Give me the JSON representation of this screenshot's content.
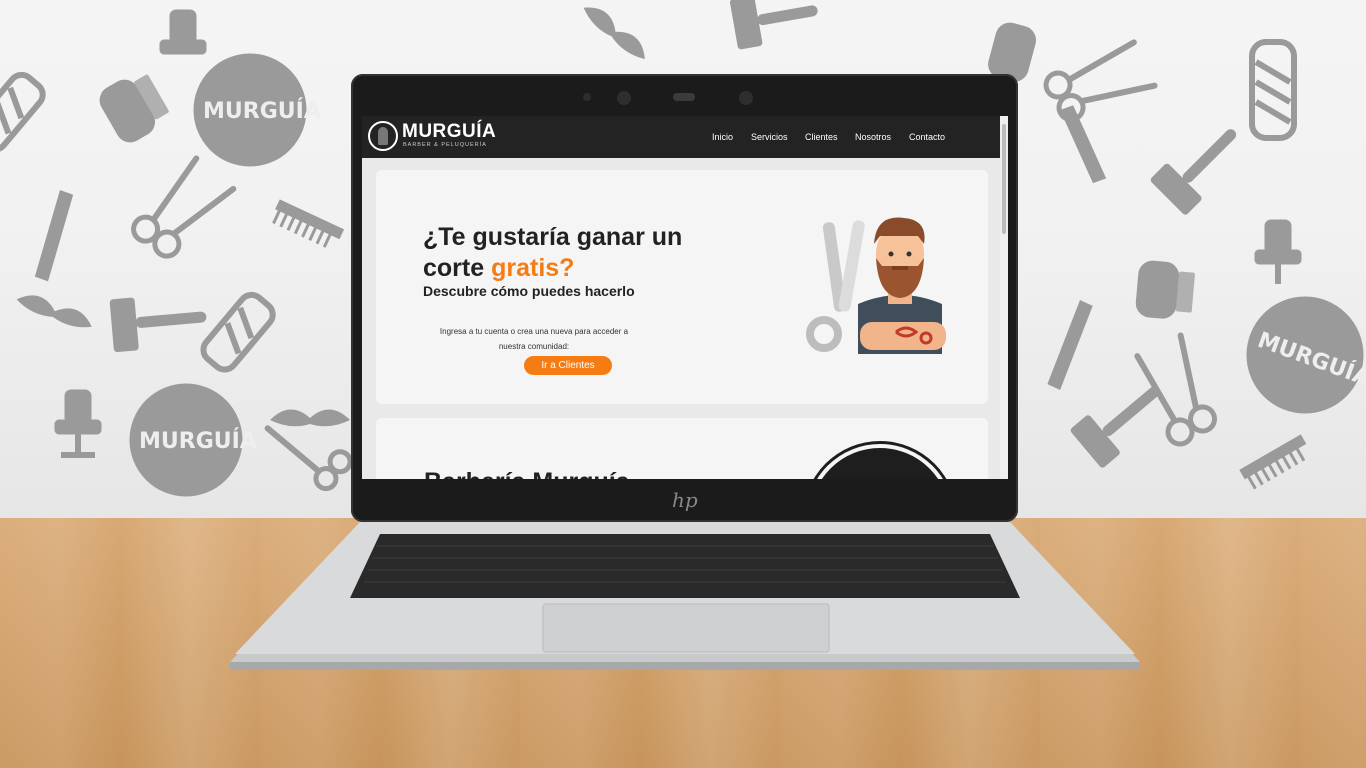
{
  "site": {
    "brand": "MURGUÍA",
    "tagline": "BARBER & PELUQUERÍA",
    "nav": [
      "Inicio",
      "Servicios",
      "Clientes",
      "Nosotros",
      "Contacto"
    ]
  },
  "hero": {
    "title_part1": "¿Te gustaría ganar un corte ",
    "title_highlight": "gratis?",
    "subtitle": "Descubre cómo puedes hacerlo",
    "body": "Ingresa a tu cuenta o crea una nueva para acceder a nuestra comunidad:",
    "cta": "Ir a Clientes"
  },
  "second_section": {
    "title_partial": "Barbería Murguía"
  },
  "laptop": {
    "logo": "hp"
  },
  "wall": {
    "logo_text": "MURGUÍA"
  },
  "colors": {
    "accent": "#f57c13",
    "nav_bg": "#232323",
    "card_bg": "#f5f5f5"
  },
  "icons": [
    "scissors-icon",
    "razor-icon",
    "clipper-icon",
    "mustache-icon",
    "barber-chair-icon",
    "barber-pole-icon",
    "comb-icon"
  ]
}
